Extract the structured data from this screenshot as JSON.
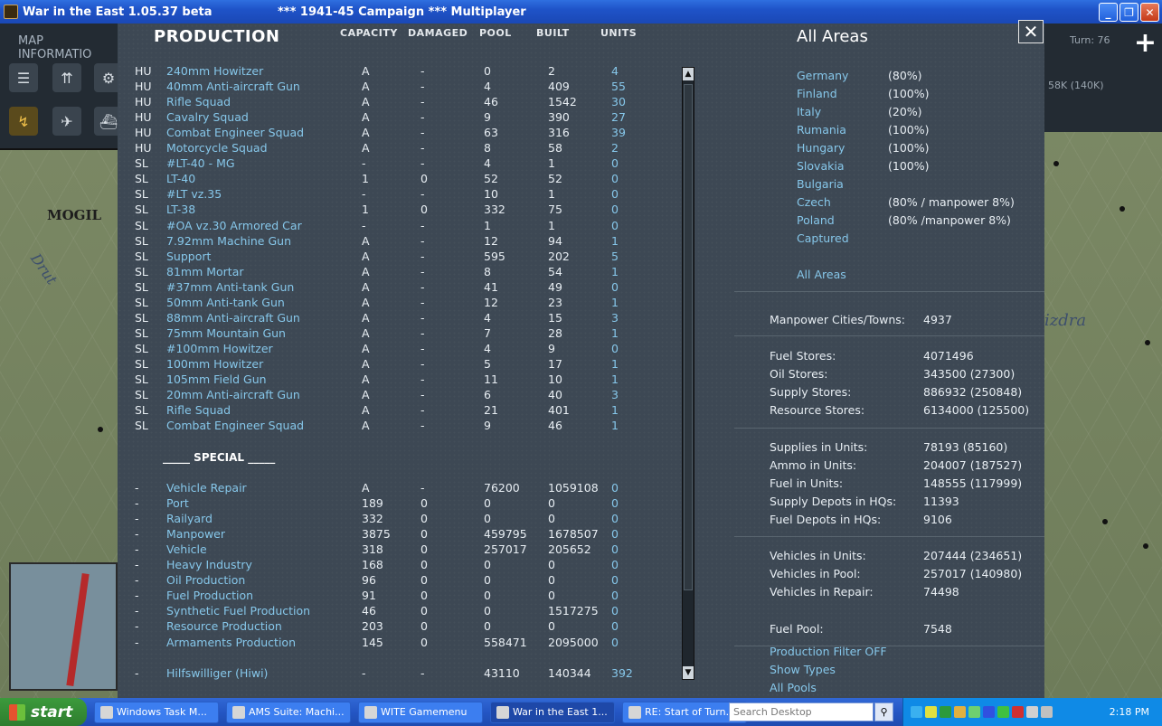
{
  "window": {
    "title": "War in the East 1.05.37 beta",
    "subtitle": "***   1941-45 Campaign   ***   Multiplayer"
  },
  "map": {
    "map_info_label": "MAP INFORMATIO",
    "city": "MOGIL",
    "river1": "Drut",
    "river2": "izdra",
    "turn": "Turn: 76",
    "manpower_box": "58K (140K)"
  },
  "production": {
    "title": "PRODUCTION",
    "columns": {
      "capacity": "CAPACITY",
      "damaged": "DAMAGED",
      "pool": "POOL",
      "built": "BUILT",
      "units": "UNITS"
    },
    "rows": [
      {
        "type": "HU",
        "name": "240mm Howitzer",
        "cap": "A",
        "dam": "-",
        "pool": "0",
        "built": "2",
        "units": "4"
      },
      {
        "type": "HU",
        "name": "40mm Anti-aircraft Gun",
        "cap": "A",
        "dam": "-",
        "pool": "4",
        "built": "409",
        "units": "55"
      },
      {
        "type": "HU",
        "name": "Rifle Squad",
        "cap": "A",
        "dam": "-",
        "pool": "46",
        "built": "1542",
        "units": "30"
      },
      {
        "type": "HU",
        "name": "Cavalry Squad",
        "cap": "A",
        "dam": "-",
        "pool": "9",
        "built": "390",
        "units": "27"
      },
      {
        "type": "HU",
        "name": "Combat Engineer Squad",
        "cap": "A",
        "dam": "-",
        "pool": "63",
        "built": "316",
        "units": "39"
      },
      {
        "type": "HU",
        "name": "Motorcycle Squad",
        "cap": "A",
        "dam": "-",
        "pool": "8",
        "built": "58",
        "units": "2"
      },
      {
        "type": "SL",
        "name": "#LT-40 - MG",
        "cap": "-",
        "dam": "-",
        "pool": "4",
        "built": "1",
        "units": "0"
      },
      {
        "type": "SL",
        "name": "LT-40",
        "cap": "1",
        "dam": "0",
        "pool": "52",
        "built": "52",
        "units": "0"
      },
      {
        "type": "SL",
        "name": "#LT vz.35",
        "cap": "-",
        "dam": "-",
        "pool": "10",
        "built": "1",
        "units": "0"
      },
      {
        "type": "SL",
        "name": "LT-38",
        "cap": "1",
        "dam": "0",
        "pool": "332",
        "built": "75",
        "units": "0"
      },
      {
        "type": "SL",
        "name": "#OA vz.30 Armored Car",
        "cap": "-",
        "dam": "-",
        "pool": "1",
        "built": "1",
        "units": "0"
      },
      {
        "type": "SL",
        "name": "7.92mm Machine Gun",
        "cap": "A",
        "dam": "-",
        "pool": "12",
        "built": "94",
        "units": "1"
      },
      {
        "type": "SL",
        "name": "Support",
        "cap": "A",
        "dam": "-",
        "pool": "595",
        "built": "202",
        "units": "5"
      },
      {
        "type": "SL",
        "name": "81mm Mortar",
        "cap": "A",
        "dam": "-",
        "pool": "8",
        "built": "54",
        "units": "1"
      },
      {
        "type": "SL",
        "name": "#37mm Anti-tank Gun",
        "cap": "A",
        "dam": "-",
        "pool": "41",
        "built": "49",
        "units": "0"
      },
      {
        "type": "SL",
        "name": "50mm Anti-tank Gun",
        "cap": "A",
        "dam": "-",
        "pool": "12",
        "built": "23",
        "units": "1"
      },
      {
        "type": "SL",
        "name": "88mm Anti-aircraft Gun",
        "cap": "A",
        "dam": "-",
        "pool": "4",
        "built": "15",
        "units": "3"
      },
      {
        "type": "SL",
        "name": "75mm Mountain Gun",
        "cap": "A",
        "dam": "-",
        "pool": "7",
        "built": "28",
        "units": "1"
      },
      {
        "type": "SL",
        "name": "#100mm Howitzer",
        "cap": "A",
        "dam": "-",
        "pool": "4",
        "built": "9",
        "units": "0"
      },
      {
        "type": "SL",
        "name": "100mm Howitzer",
        "cap": "A",
        "dam": "-",
        "pool": "5",
        "built": "17",
        "units": "1"
      },
      {
        "type": "SL",
        "name": "105mm Field Gun",
        "cap": "A",
        "dam": "-",
        "pool": "11",
        "built": "10",
        "units": "1"
      },
      {
        "type": "SL",
        "name": "20mm Anti-aircraft Gun",
        "cap": "A",
        "dam": "-",
        "pool": "6",
        "built": "40",
        "units": "3"
      },
      {
        "type": "SL",
        "name": "Rifle Squad",
        "cap": "A",
        "dam": "-",
        "pool": "21",
        "built": "401",
        "units": "1"
      },
      {
        "type": "SL",
        "name": "Combat Engineer Squad",
        "cap": "A",
        "dam": "-",
        "pool": "9",
        "built": "46",
        "units": "1"
      }
    ],
    "special_label": "_____ SPECIAL _____",
    "special_rows": [
      {
        "type": "-",
        "name": "Vehicle Repair",
        "cap": "A",
        "dam": "-",
        "pool": "76200",
        "built": "1059108",
        "units": "0"
      },
      {
        "type": "-",
        "name": "Port",
        "cap": "189",
        "dam": "0",
        "pool": "0",
        "built": "0",
        "units": "0"
      },
      {
        "type": "-",
        "name": "Railyard",
        "cap": "332",
        "dam": "0",
        "pool": "0",
        "built": "0",
        "units": "0"
      },
      {
        "type": "-",
        "name": "Manpower",
        "cap": "3875",
        "dam": "0",
        "pool": "459795",
        "built": "1678507",
        "units": "0"
      },
      {
        "type": "-",
        "name": "Vehicle",
        "cap": "318",
        "dam": "0",
        "pool": "257017",
        "built": "205652",
        "units": "0"
      },
      {
        "type": "-",
        "name": "Heavy Industry",
        "cap": "168",
        "dam": "0",
        "pool": "0",
        "built": "0",
        "units": "0"
      },
      {
        "type": "-",
        "name": "Oil Production",
        "cap": "96",
        "dam": "0",
        "pool": "0",
        "built": "0",
        "units": "0"
      },
      {
        "type": "-",
        "name": "Fuel Production",
        "cap": "91",
        "dam": "0",
        "pool": "0",
        "built": "0",
        "units": "0"
      },
      {
        "type": "-",
        "name": "Synthetic Fuel Production",
        "cap": "46",
        "dam": "0",
        "pool": "0",
        "built": "1517275",
        "units": "0"
      },
      {
        "type": "-",
        "name": "Resource Production",
        "cap": "203",
        "dam": "0",
        "pool": "0",
        "built": "0",
        "units": "0"
      },
      {
        "type": "-",
        "name": "Armaments Production",
        "cap": "145",
        "dam": "0",
        "pool": "558471",
        "built": "2095000",
        "units": "0"
      }
    ],
    "hiwi_row": {
      "type": "-",
      "name": "Hilfswilliger (Hiwi)",
      "cap": "-",
      "dam": "-",
      "pool": "43110",
      "built": "140344",
      "units": "392"
    }
  },
  "areas": {
    "title": "All Areas",
    "countries": [
      {
        "name": "Germany",
        "value": "(80%)"
      },
      {
        "name": "Finland",
        "value": "(100%)"
      },
      {
        "name": "Italy",
        "value": "(20%)"
      },
      {
        "name": "Rumania",
        "value": "(100%)"
      },
      {
        "name": "Hungary",
        "value": "(100%)"
      },
      {
        "name": "Slovakia",
        "value": "(100%)"
      },
      {
        "name": "Bulgaria",
        "value": ""
      },
      {
        "name": "Czech",
        "value": "(80% / manpower 8%)"
      },
      {
        "name": "Poland",
        "value": "(80% /manpower 8%)"
      },
      {
        "name": "Captured",
        "value": ""
      }
    ],
    "all_areas_link": "All Areas",
    "stats_group1": [
      {
        "label": "Manpower Cities/Towns:",
        "value": "4937"
      }
    ],
    "stats_group2": [
      {
        "label": "Fuel Stores:",
        "value": "4071496"
      },
      {
        "label": "Oil Stores:",
        "value": "343500 (27300)"
      },
      {
        "label": "Supply Stores:",
        "value": "886932 (250848)"
      },
      {
        "label": "Resource Stores:",
        "value": "6134000 (125500)"
      }
    ],
    "stats_group3": [
      {
        "label": "Supplies in Units:",
        "value": "78193 (85160)"
      },
      {
        "label": "Ammo in Units:",
        "value": "204007 (187527)"
      },
      {
        "label": "Fuel in Units:",
        "value": "148555 (117999)"
      },
      {
        "label": "Supply Depots in HQs:",
        "value": "11393"
      },
      {
        "label": "Fuel Depots in HQs:",
        "value": "9106"
      }
    ],
    "stats_group4": [
      {
        "label": "Vehicles in Units:",
        "value": "207444 (234651)"
      },
      {
        "label": "Vehicles in Pool:",
        "value": "257017 (140980)"
      },
      {
        "label": "Vehicles in Repair:",
        "value": "74498"
      }
    ],
    "fuel_pool": {
      "label": "Fuel Pool:",
      "value": "7548"
    },
    "links": [
      "Production Filter OFF",
      "Show Types",
      "All Pools"
    ]
  },
  "taskbar": {
    "start": "start",
    "tasks": [
      {
        "label": "Windows Task M...",
        "active": false
      },
      {
        "label": "AMS Suite: Machi...",
        "active": false
      },
      {
        "label": "WITE Gamemenu",
        "active": false
      },
      {
        "label": "War in the East 1...",
        "active": true
      },
      {
        "label": "RE: Start of Turn...",
        "active": false
      }
    ],
    "search_placeholder": "Search Desktop",
    "clock": "2:18 PM"
  }
}
